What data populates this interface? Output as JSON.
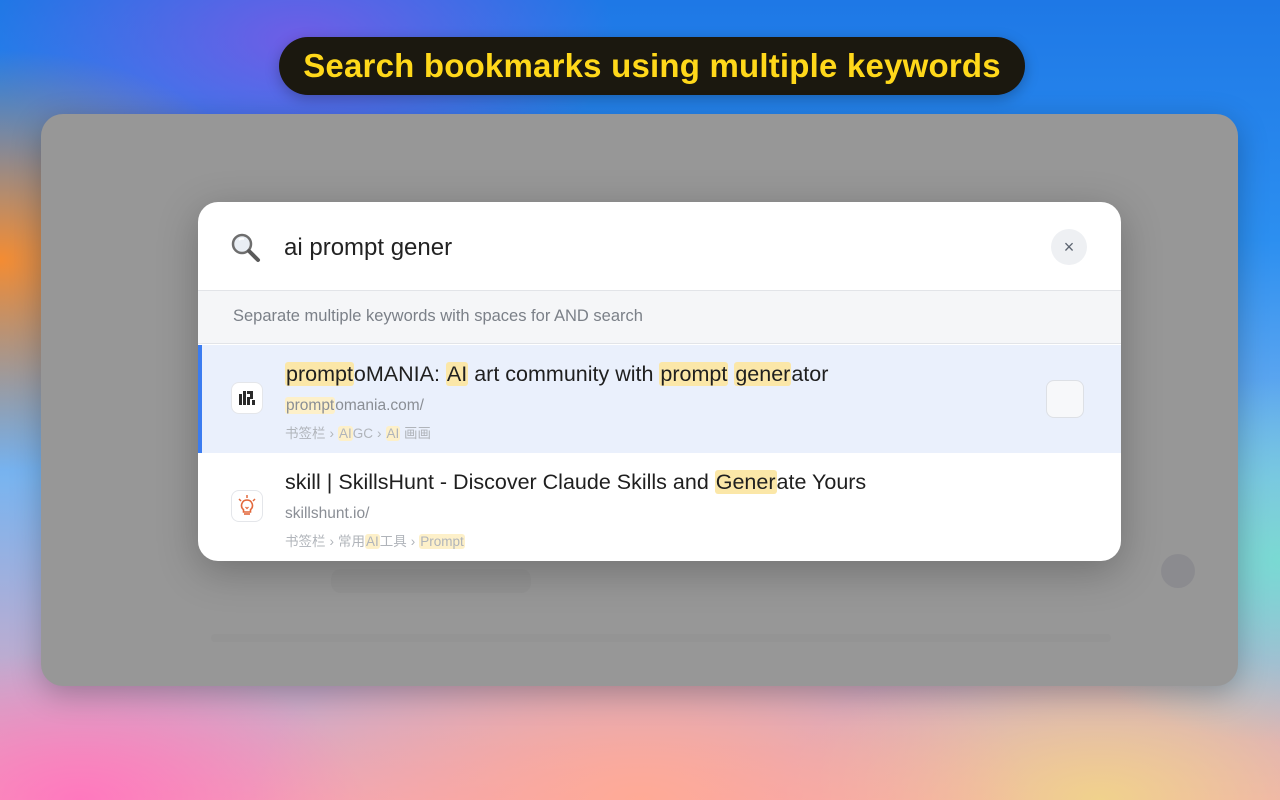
{
  "banner": {
    "text": "Search bookmarks using multiple keywords"
  },
  "search": {
    "value": "ai prompt gener",
    "clear_label": "×"
  },
  "hint": {
    "text": "Separate multiple keywords with spaces for AND search"
  },
  "results": [
    {
      "title": {
        "t1": "prompt",
        "t2": "oMANIA: ",
        "t3": "AI",
        "t4": " art community with ",
        "t5": "prompt",
        "t6": " ",
        "t7": "gener",
        "t8": "ator"
      },
      "url": {
        "u1": "prompt",
        "u2": "omania.com/"
      },
      "path": {
        "p1": "书签栏",
        "sep": "›",
        "p2": "AI",
        "p3": "GC",
        "p4": "AI",
        "p5": " 画画"
      },
      "favicon": "promptomania-logo-icon",
      "selected": true
    },
    {
      "title": {
        "t1": "skill | SkillsHunt - Discover Claude Skills and ",
        "t2": "Gener",
        "t3": "ate Yours"
      },
      "url": {
        "u1": "skillshunt.io/"
      },
      "path": {
        "p1": "书签栏",
        "sep": "›",
        "p2": "常用",
        "p3": "AI",
        "p4": "工具",
        "p5": "Prompt"
      },
      "favicon": "lightbulb-icon",
      "selected": false
    }
  ],
  "colors": {
    "accent": "#3b7cf0",
    "highlight": "#fbe7a8",
    "banner_text": "#ffd81a",
    "banner_bg": "#1b180f"
  }
}
